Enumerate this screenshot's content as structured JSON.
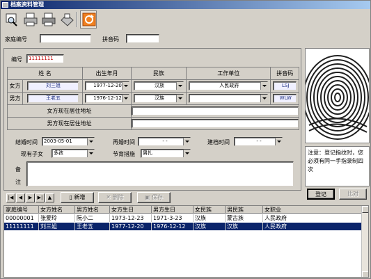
{
  "window": {
    "title": "档案资料管理"
  },
  "search": {
    "family_no_label": "家庭编号",
    "family_no_value": "",
    "pinyin_label": "拼音码",
    "pinyin_value": ""
  },
  "record": {
    "id_label": "编号",
    "id_value": "11111111"
  },
  "table": {
    "headers": {
      "name": "姓  名",
      "birth": "出生年月",
      "ethnicity": "民族",
      "work": "工作单位",
      "pinyin": "拼音码"
    },
    "wife": {
      "role": "女方",
      "name": "刘三姐",
      "birth": "1977-12-20",
      "ethnicity": "汉族",
      "work": "人民政府",
      "pinyin": "LSJ"
    },
    "husband": {
      "role": "男方",
      "name": "王老五",
      "birth": "1976-12-12",
      "ethnicity": "汉族",
      "work": "",
      "pinyin": "WLW"
    },
    "wife_addr_label": "女方现在居住地址",
    "husband_addr_label": "男方现在居住地址"
  },
  "marriage": {
    "married_label": "结婚时间",
    "married_value": "2003-05-01",
    "remarried_label": "再婚时间",
    "remarried_value": "- -",
    "filing_label": "建档时间",
    "filing_value": "- -"
  },
  "children": {
    "label": "现有子女",
    "value": "多孩",
    "contraception_label": "节育措施",
    "contraception_value": "男扎"
  },
  "remarks": {
    "label1": "备",
    "label2": "注"
  },
  "nav": {
    "first": "|◀",
    "prev": "◀",
    "next": "▶",
    "last": "▶|",
    "extra": "▲"
  },
  "actions": {
    "add": "新增",
    "delete": "删除",
    "save": "保存"
  },
  "fingerprint": {
    "note": "注意：登记指纹时，您必须有同一手指录制四次",
    "register": "登记",
    "verify": "比对"
  },
  "grid": {
    "columns": [
      "家庭编号",
      "女方姓名",
      "男方姓名",
      "女方生日",
      "男方生日",
      "女民族",
      "男民族",
      "女职业"
    ],
    "rows": [
      [
        "00000001",
        "张爱玲",
        "阮小二",
        "1973-12-23",
        "1971-3-23",
        "汉族",
        "蒙古族",
        "人民政府"
      ],
      [
        "11111111",
        "刘三姐",
        "王老五",
        "1977-12-20",
        "1976-12-12",
        "汉族",
        "汉族",
        "人民政府"
      ]
    ],
    "selected_row": 1
  },
  "colors": {
    "title_from": "#0a246a",
    "title_to": "#a6caf0",
    "selection": "#0a246a"
  }
}
